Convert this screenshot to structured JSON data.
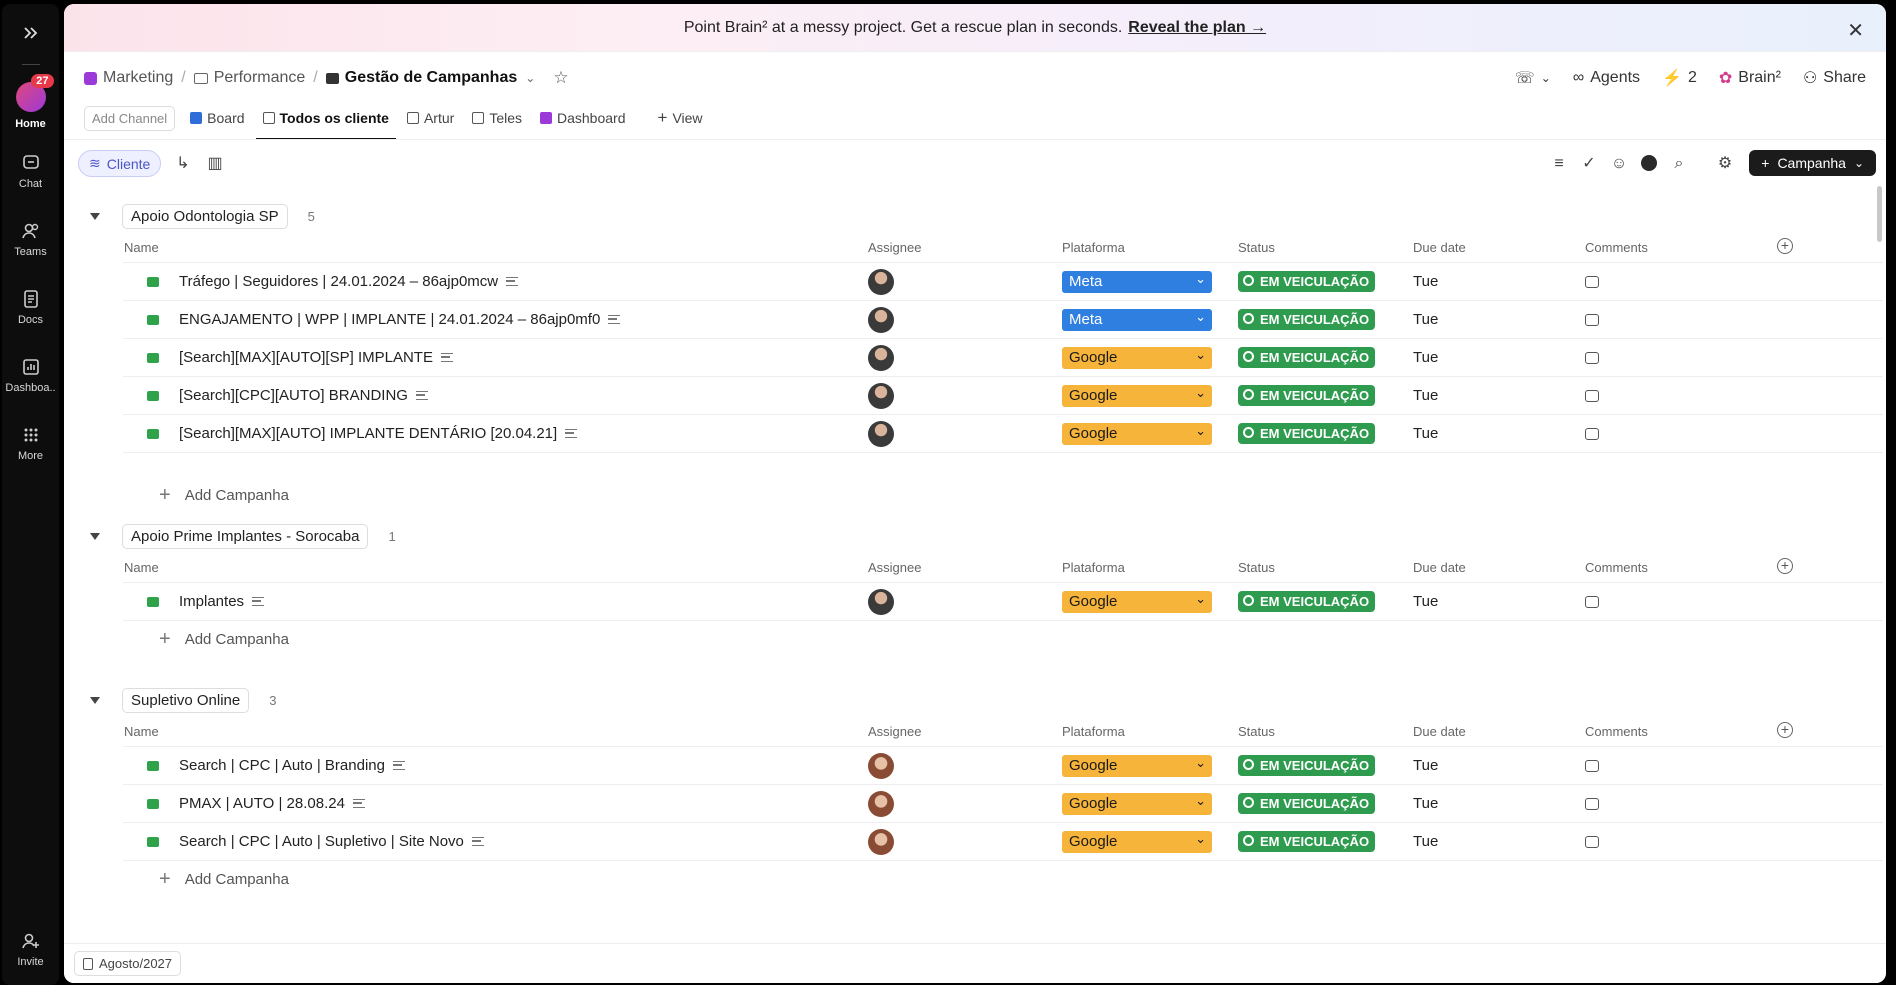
{
  "rail": {
    "home_badge": "27",
    "items": [
      {
        "label": "Home"
      },
      {
        "label": "Chat"
      },
      {
        "label": "Teams"
      },
      {
        "label": "Docs"
      },
      {
        "label": "Dashboa.."
      },
      {
        "label": "More"
      },
      {
        "label": "Invite"
      }
    ]
  },
  "banner": {
    "text": "Point Brain² at a messy project. Get a rescue plan in seconds.",
    "link": "Reveal the plan →"
  },
  "breadcrumb": {
    "space": "Marketing",
    "folder": "Performance",
    "list": "Gestão de Campanhas"
  },
  "header_actions": {
    "agents": "Agents",
    "bolt_count": "2",
    "brain": "Brain²",
    "share": "Share"
  },
  "tabs": {
    "add_channel": "Add Channel",
    "items": [
      {
        "label": "Board"
      },
      {
        "label": "Todos os cliente"
      },
      {
        "label": "Artur"
      },
      {
        "label": "Teles"
      },
      {
        "label": "Dashboard"
      }
    ],
    "view": "View"
  },
  "toolbar": {
    "group_by": "Cliente",
    "new_button": "Campanha"
  },
  "columns": {
    "name": "Name",
    "assignee": "Assignee",
    "plataforma": "Plataforma",
    "status": "Status",
    "due": "Due date",
    "comments": "Comments"
  },
  "groups": [
    {
      "name": "Apoio Odontologia SP",
      "count": "5",
      "add": "Add Campanha",
      "rows": [
        {
          "name": "Tráfego | Seguidores | 24.01.2024 – 86ajp0mcw",
          "plataforma": "Meta",
          "status": "EM VEICULAÇÃO",
          "due": "Tue"
        },
        {
          "name": "ENGAJAMENTO | WPP | IMPLANTE | 24.01.2024 – 86ajp0mf0",
          "plataforma": "Meta",
          "status": "EM VEICULAÇÃO",
          "due": "Tue"
        },
        {
          "name": "[Search][MAX][AUTO][SP] IMPLANTE",
          "plataforma": "Google",
          "status": "EM VEICULAÇÃO",
          "due": "Tue"
        },
        {
          "name": "[Search][CPC][AUTO] BRANDING",
          "plataforma": "Google",
          "status": "EM VEICULAÇÃO",
          "due": "Tue"
        },
        {
          "name": "[Search][MAX][AUTO] IMPLANTE DENTÁRIO [20.04.21]",
          "plataforma": "Google",
          "status": "EM VEICULAÇÃO",
          "due": "Tue"
        }
      ]
    },
    {
      "name": "Apoio Prime Implantes - Sorocaba",
      "count": "1",
      "add": "Add Campanha",
      "rows": [
        {
          "name": "Implantes",
          "plataforma": "Google",
          "status": "EM VEICULAÇÃO",
          "due": "Tue"
        }
      ]
    },
    {
      "name": "Supletivo Online",
      "count": "3",
      "add": "Add Campanha",
      "rows": [
        {
          "name": "Search | CPC | Auto | Branding",
          "plataforma": "Google",
          "status": "EM VEICULAÇÃO",
          "due": "Tue"
        },
        {
          "name": "PMAX | AUTO | 28.08.24",
          "plataforma": "Google",
          "status": "EM VEICULAÇÃO",
          "due": "Tue"
        },
        {
          "name": "Search | CPC | Auto | Supletivo | Site Novo",
          "plataforma": "Google",
          "status": "EM VEICULAÇÃO",
          "due": "Tue"
        }
      ]
    }
  ],
  "colors": {
    "meta": "#2f7fe0",
    "google": "#f7b43a",
    "status_green": "#2e9b4f"
  },
  "bottom": {
    "doc_tab": "Agosto/2027"
  }
}
